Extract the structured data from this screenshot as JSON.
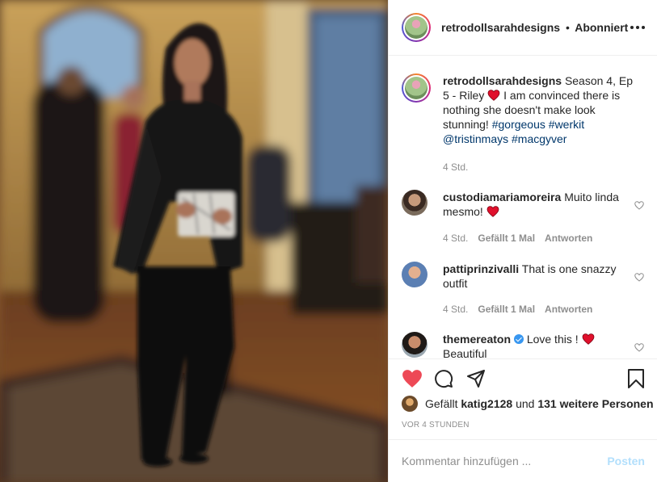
{
  "header": {
    "username": "retrodollsarahdesigns",
    "separator": "•",
    "follow_status": "Abonniert",
    "more_icon": "more-dots-icon"
  },
  "caption": {
    "username": "retrodollsarahdesigns",
    "text_1": "Season 4, Ep 5 - Riley",
    "text_2": "I am convinced there is nothing she doesn't make look stunning!",
    "tags": [
      "#gorgeous",
      "#werkit",
      "@tristinmays",
      "#macgyver"
    ],
    "time": "4 Std."
  },
  "comments": [
    {
      "username": "custodiamariamoreira",
      "text": "Muito linda mesmo!",
      "time": "4 Std.",
      "likes": "Gefällt 1 Mal",
      "reply": "Antworten"
    },
    {
      "username": "pattiprinzivalli",
      "text": "That is one snazzy outfit",
      "time": "4 Std.",
      "likes": "Gefällt 1 Mal",
      "reply": "Antworten"
    },
    {
      "username": "themereaton",
      "text": "Love this !",
      "text_2": "Beautiful"
    }
  ],
  "actions": {
    "like_icon": "heart-filled-icon",
    "comment_icon": "comment-icon",
    "share_icon": "share-icon",
    "save_icon": "bookmark-icon"
  },
  "likes": {
    "prefix": "Gefällt",
    "user": "katig2128",
    "suffix": "und",
    "others": "131 weitere Personen"
  },
  "timestamp": "VOR 4 STUNDEN",
  "compose": {
    "placeholder": "Kommentar hinzufügen ...",
    "post_label": "Posten"
  },
  "colors": {
    "like_red": "#ed4956",
    "link_blue": "#00376b",
    "verified_blue": "#3897f0",
    "post_disabled": "#b2dffc"
  }
}
